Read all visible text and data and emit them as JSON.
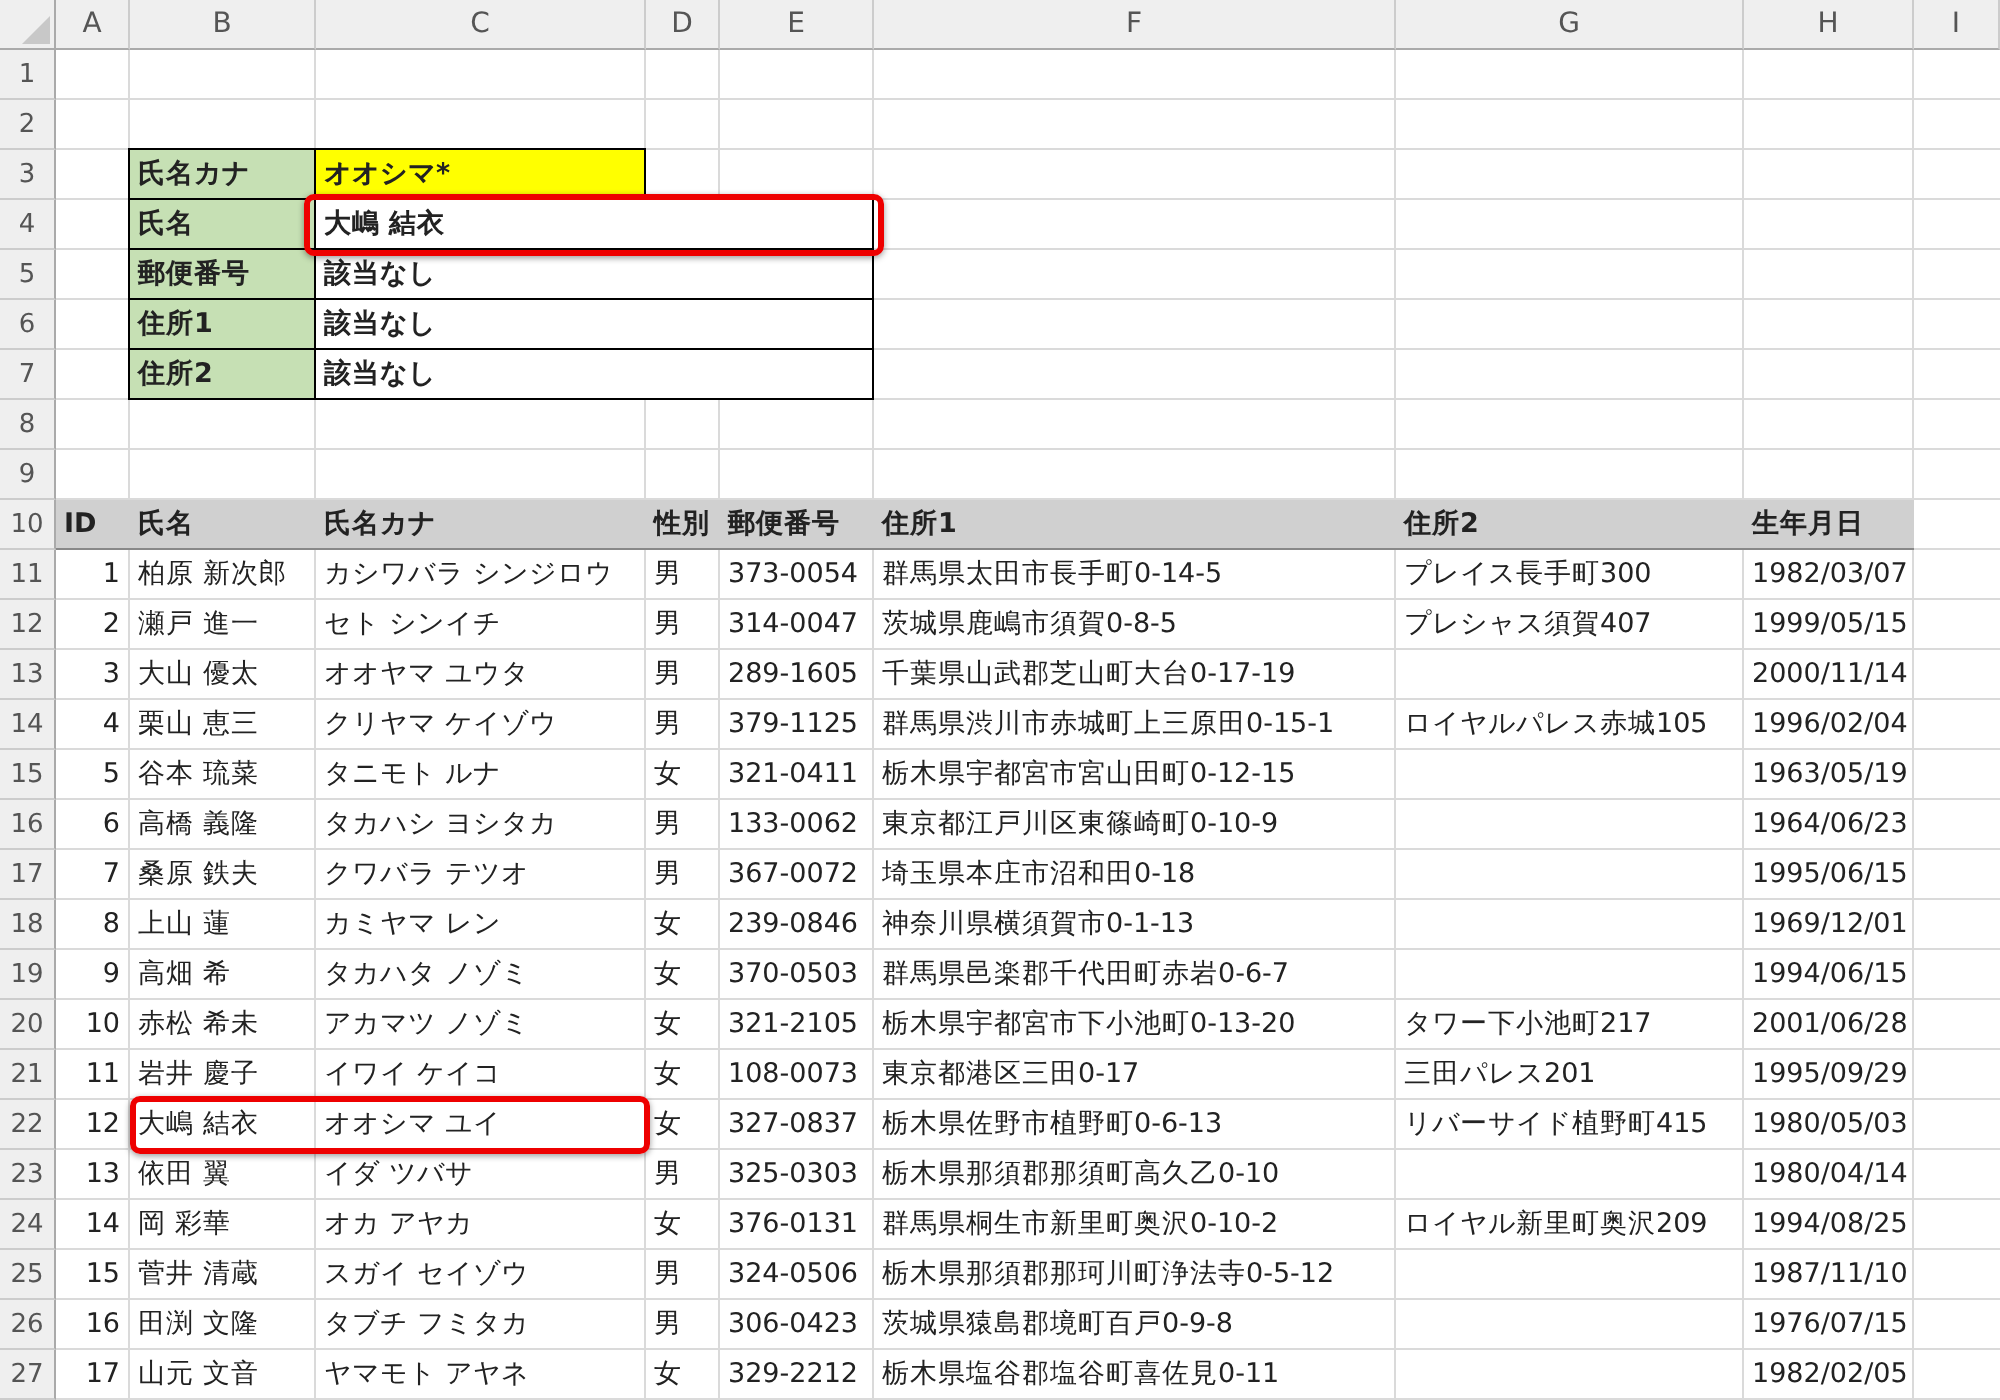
{
  "column_headers": [
    "A",
    "B",
    "C",
    "D",
    "E",
    "F",
    "G",
    "H",
    "I"
  ],
  "row_headers": [
    "1",
    "2",
    "3",
    "4",
    "5",
    "6",
    "7",
    "8",
    "9",
    "10",
    "11",
    "12",
    "13",
    "14",
    "15",
    "16",
    "17",
    "18",
    "19",
    "20",
    "21",
    "22",
    "23",
    "24",
    "25",
    "26",
    "27"
  ],
  "lookup": {
    "rows": [
      {
        "label": "氏名カナ",
        "value": "オオシマ*",
        "kind": "input",
        "highlighted": false
      },
      {
        "label": "氏名",
        "value": "大嶋 結衣",
        "kind": "output",
        "highlighted": true
      },
      {
        "label": "郵便番号",
        "value": "該当なし",
        "kind": "output",
        "highlighted": false
      },
      {
        "label": "住所1",
        "value": "該当なし",
        "kind": "output",
        "highlighted": false
      },
      {
        "label": "住所2",
        "value": "該当なし",
        "kind": "output",
        "highlighted": false
      }
    ]
  },
  "table": {
    "columns": [
      "ID",
      "氏名",
      "氏名カナ",
      "性別",
      "郵便番号",
      "住所1",
      "住所2",
      "生年月日"
    ],
    "rows": [
      {
        "id": "1",
        "name": "柏原 新次郎",
        "kana": "カシワバラ シンジロウ",
        "gender": "男",
        "zip": "373-0054",
        "address1": "群馬県太田市長手町0-14-5",
        "address2": "プレイス長手町300",
        "birthdate": "1982/03/07",
        "highlighted": false
      },
      {
        "id": "2",
        "name": "瀬戸 進一",
        "kana": "セト シンイチ",
        "gender": "男",
        "zip": "314-0047",
        "address1": "茨城県鹿嶋市須賀0-8-5",
        "address2": "プレシャス須賀407",
        "birthdate": "1999/05/15",
        "highlighted": false
      },
      {
        "id": "3",
        "name": "大山 優太",
        "kana": "オオヤマ ユウタ",
        "gender": "男",
        "zip": "289-1605",
        "address1": "千葉県山武郡芝山町大台0-17-19",
        "birthdate": "2000/11/14",
        "highlighted": false
      },
      {
        "id": "4",
        "name": "栗山 恵三",
        "kana": "クリヤマ ケイゾウ",
        "gender": "男",
        "zip": "379-1125",
        "address1": "群馬県渋川市赤城町上三原田0-15-1",
        "address2": "ロイヤルパレス赤城105",
        "birthdate": "1996/02/04",
        "highlighted": false
      },
      {
        "id": "5",
        "name": "谷本 琉菜",
        "kana": "タニモト ルナ",
        "gender": "女",
        "zip": "321-0411",
        "address1": "栃木県宇都宮市宮山田町0-12-15",
        "birthdate": "1963/05/19",
        "highlighted": false
      },
      {
        "id": "6",
        "name": "高橋 義隆",
        "kana": "タカハシ ヨシタカ",
        "gender": "男",
        "zip": "133-0062",
        "address1": "東京都江戸川区東篠崎町0-10-9",
        "birthdate": "1964/06/23",
        "highlighted": false
      },
      {
        "id": "7",
        "name": "桑原 鉄夫",
        "kana": "クワバラ テツオ",
        "gender": "男",
        "zip": "367-0072",
        "address1": "埼玉県本庄市沼和田0-18",
        "birthdate": "1995/06/15",
        "highlighted": false
      },
      {
        "id": "8",
        "name": "上山 蓮",
        "kana": "カミヤマ レン",
        "gender": "女",
        "zip": "239-0846",
        "address1": "神奈川県横須賀市0-1-13",
        "birthdate": "1969/12/01",
        "highlighted": false
      },
      {
        "id": "9",
        "name": "高畑 希",
        "kana": "タカハタ ノゾミ",
        "gender": "女",
        "zip": "370-0503",
        "address1": "群馬県邑楽郡千代田町赤岩0-6-7",
        "birthdate": "1994/06/15",
        "highlighted": false
      },
      {
        "id": "10",
        "name": "赤松 希未",
        "kana": "アカマツ ノゾミ",
        "gender": "女",
        "zip": "321-2105",
        "address1": "栃木県宇都宮市下小池町0-13-20",
        "address2": "タワー下小池町217",
        "birthdate": "2001/06/28",
        "highlighted": false
      },
      {
        "id": "11",
        "name": "岩井 慶子",
        "kana": "イワイ ケイコ",
        "gender": "女",
        "zip": "108-0073",
        "address1": "東京都港区三田0-17",
        "address2": "三田パレス201",
        "birthdate": "1995/09/29",
        "highlighted": false
      },
      {
        "id": "12",
        "name": "大嶋 結衣",
        "kana": "オオシマ ユイ",
        "gender": "女",
        "zip": "327-0837",
        "address1": "栃木県佐野市植野町0-6-13",
        "address2": "リバーサイド植野町415",
        "birthdate": "1980/05/03",
        "highlighted": true
      },
      {
        "id": "13",
        "name": "依田 翼",
        "kana": "イダ ツバサ",
        "gender": "男",
        "zip": "325-0303",
        "address1": "栃木県那須郡那須町高久乙0-10",
        "birthdate": "1980/04/14",
        "highlighted": false
      },
      {
        "id": "14",
        "name": "岡 彩華",
        "kana": "オカ アヤカ",
        "gender": "女",
        "zip": "376-0131",
        "address1": "群馬県桐生市新里町奥沢0-10-2",
        "address2": "ロイヤル新里町奥沢209",
        "birthdate": "1994/08/25",
        "highlighted": false
      },
      {
        "id": "15",
        "name": "菅井 清蔵",
        "kana": "スガイ セイゾウ",
        "gender": "男",
        "zip": "324-0506",
        "address1": "栃木県那須郡那珂川町浄法寺0-5-12",
        "birthdate": "1987/11/10",
        "highlighted": false
      },
      {
        "id": "16",
        "name": "田渕 文隆",
        "kana": "タブチ フミタカ",
        "gender": "男",
        "zip": "306-0423",
        "address1": "茨城県猿島郡境町百戸0-9-8",
        "birthdate": "1976/07/15",
        "highlighted": false
      },
      {
        "id": "17",
        "name": "山元 文音",
        "kana": "ヤマモト アヤネ",
        "gender": "女",
        "zip": "329-2212",
        "address1": "栃木県塩谷郡塩谷町喜佐見0-11",
        "birthdate": "1982/02/05",
        "highlighted": false
      }
    ]
  }
}
